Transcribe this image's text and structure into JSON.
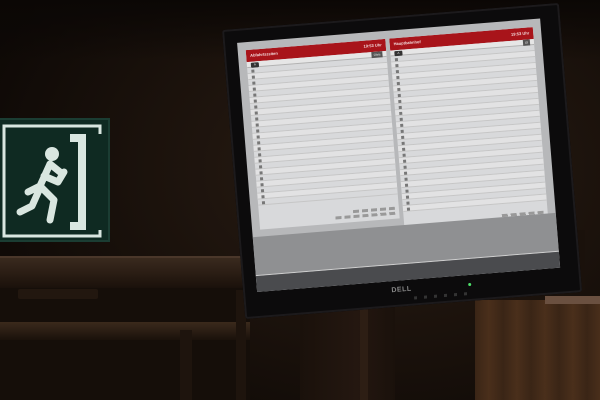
{
  "monitor": {
    "brand": "DELL",
    "colors": {
      "header_red": "#a8141a",
      "screen_bg": "#b7b8ba",
      "exit_green": "#0f2a22"
    }
  },
  "exit_sign": {
    "icon": "running-man-exit-icon"
  },
  "left_panel": {
    "title": "Abfahrtszeiten",
    "clock": "19:53 Uhr",
    "subhead_badge": "A",
    "subhead_label": "",
    "track_heading": "Gleis",
    "rows": [
      {
        "dest": "",
        "info": "",
        "track": ""
      },
      {
        "dest": "",
        "info": "",
        "track": ""
      },
      {
        "dest": "",
        "info": "",
        "track": ""
      },
      {
        "dest": "",
        "info": "",
        "track": ""
      },
      {
        "dest": "",
        "info": "",
        "track": ""
      },
      {
        "dest": "",
        "info": "",
        "track": ""
      },
      {
        "dest": "",
        "info": "",
        "track": ""
      },
      {
        "dest": "",
        "info": "",
        "track": ""
      },
      {
        "dest": "",
        "info": "",
        "track": ""
      },
      {
        "dest": "",
        "info": "",
        "track": ""
      },
      {
        "dest": "",
        "info": "",
        "track": ""
      },
      {
        "dest": "",
        "info": "",
        "track": ""
      },
      {
        "dest": "",
        "info": "",
        "track": ""
      },
      {
        "dest": "",
        "info": "",
        "track": ""
      },
      {
        "dest": "",
        "info": "",
        "track": ""
      },
      {
        "dest": "",
        "info": "",
        "track": ""
      },
      {
        "dest": "",
        "info": "",
        "track": ""
      },
      {
        "dest": "",
        "info": "",
        "track": ""
      },
      {
        "dest": "",
        "info": "",
        "track": ""
      },
      {
        "dest": "",
        "info": "",
        "track": ""
      },
      {
        "dest": "",
        "info": "",
        "track": ""
      },
      {
        "dest": "",
        "info": "",
        "track": ""
      },
      {
        "dest": "",
        "info": "",
        "track": ""
      }
    ]
  },
  "right_panel": {
    "title": "Hauptbahnhof",
    "clock": "19:53 Uhr",
    "subhead_badge": "A",
    "subhead_label": "",
    "track_heading": "Gl",
    "rows": [
      {
        "dest": "",
        "info": "",
        "track": ""
      },
      {
        "dest": "",
        "info": "",
        "track": ""
      },
      {
        "dest": "",
        "info": "",
        "track": ""
      },
      {
        "dest": "",
        "info": "",
        "track": ""
      },
      {
        "dest": "",
        "info": "",
        "track": ""
      },
      {
        "dest": "",
        "info": "",
        "track": ""
      },
      {
        "dest": "",
        "info": "",
        "track": ""
      },
      {
        "dest": "",
        "info": "",
        "track": ""
      },
      {
        "dest": "",
        "info": "",
        "track": ""
      },
      {
        "dest": "",
        "info": "",
        "track": ""
      },
      {
        "dest": "",
        "info": "",
        "track": ""
      },
      {
        "dest": "",
        "info": "",
        "track": ""
      },
      {
        "dest": "",
        "info": "",
        "track": ""
      },
      {
        "dest": "",
        "info": "",
        "track": ""
      },
      {
        "dest": "",
        "info": "",
        "track": ""
      },
      {
        "dest": "",
        "info": "",
        "track": ""
      },
      {
        "dest": "",
        "info": "",
        "track": ""
      },
      {
        "dest": "",
        "info": "",
        "track": ""
      },
      {
        "dest": "",
        "info": "",
        "track": ""
      },
      {
        "dest": "",
        "info": "",
        "track": ""
      },
      {
        "dest": "",
        "info": "",
        "track": ""
      },
      {
        "dest": "",
        "info": "",
        "track": ""
      },
      {
        "dest": "",
        "info": "",
        "track": ""
      },
      {
        "dest": "",
        "info": "",
        "track": ""
      },
      {
        "dest": "",
        "info": "",
        "track": ""
      },
      {
        "dest": "",
        "info": "",
        "track": ""
      }
    ]
  }
}
